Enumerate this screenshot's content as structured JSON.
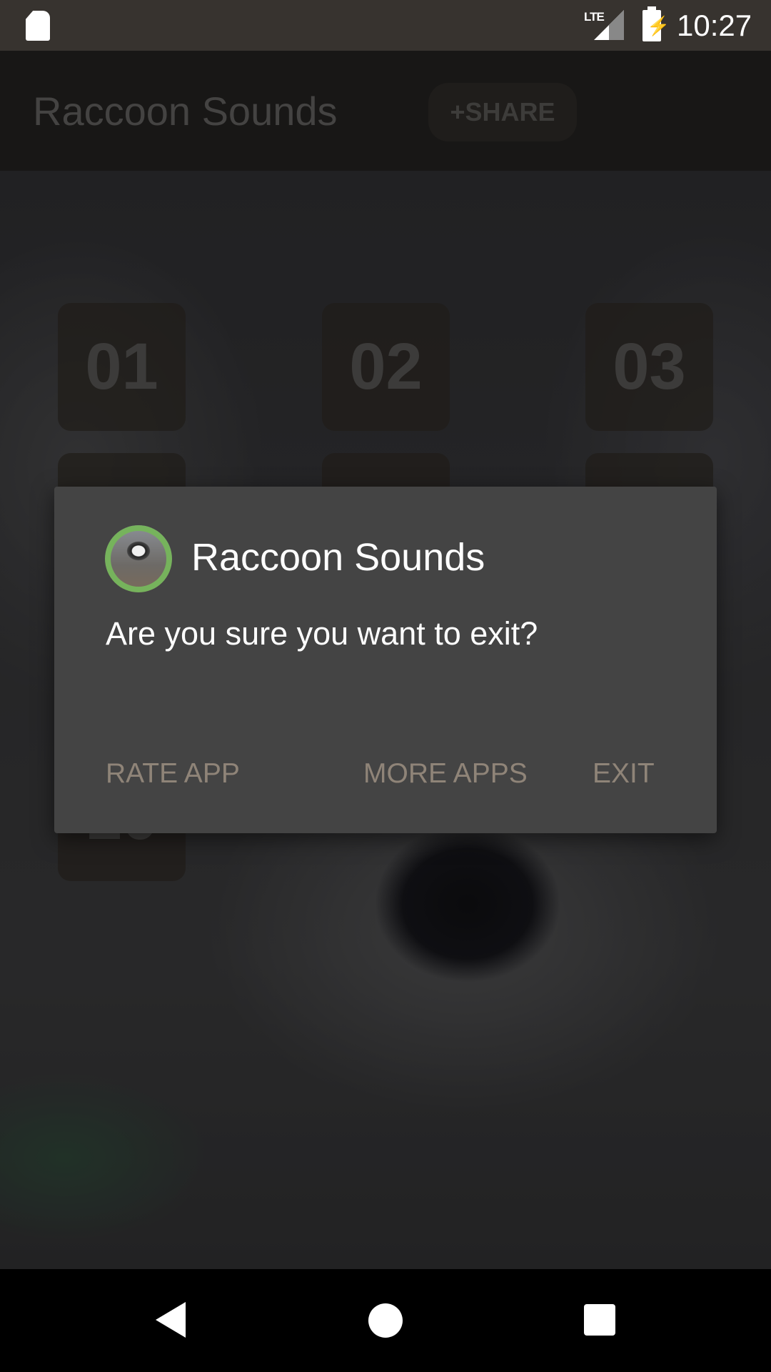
{
  "status_bar": {
    "time": "10:27",
    "network": "LTE",
    "icons": [
      "sd-card-icon",
      "signal-icon",
      "battery-charging-icon"
    ]
  },
  "toolbar": {
    "title": "Raccoon Sounds",
    "share_label": "+SHARE"
  },
  "grid": {
    "tiles": [
      "01",
      "02",
      "03",
      "",
      "",
      "",
      "",
      "",
      "",
      "10"
    ]
  },
  "dialog": {
    "title": "Raccoon Sounds",
    "message": "Are you sure you want to exit?",
    "buttons": {
      "rate": "RATE APP",
      "more": "MORE APPS",
      "exit": "EXIT"
    },
    "button_color": "#8f8478"
  },
  "nav_bar": {
    "icons": [
      "back-icon",
      "home-icon",
      "recents-icon"
    ]
  }
}
